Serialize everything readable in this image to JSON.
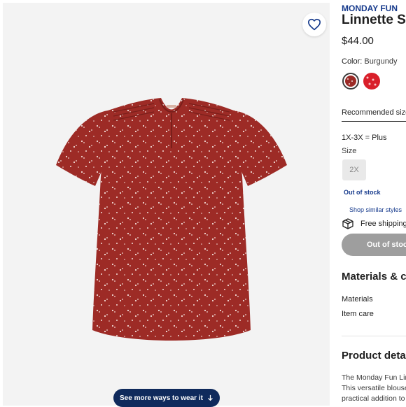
{
  "product": {
    "brand": "MONDAY FUN",
    "name": "Linnette Sp",
    "price": "$44.00"
  },
  "color": {
    "label": "Color:",
    "value": "Burgundy",
    "swatches": [
      {
        "name": "Burgundy",
        "hex": "#9b2a26"
      },
      {
        "name": "Red",
        "hex": "#d91f2a"
      }
    ]
  },
  "sizing": {
    "recommended": "Recommended size",
    "range": "1X-3X = Plus",
    "label": "Size",
    "option": "2X",
    "status": "Out of stock"
  },
  "links": {
    "shop_similar": "Shop similar styles"
  },
  "shipping": {
    "text": "Free shipping"
  },
  "cta": {
    "label": "Out of stock"
  },
  "materials": {
    "title": "Materials & ca",
    "row1": "Materials",
    "row2": "Item care"
  },
  "details": {
    "title": "Product detai",
    "lines": [
      "The Monday Fun Lin",
      "This versatile blouse",
      "practical addition to"
    ]
  },
  "gallery": {
    "wear_button": "See more ways to wear it"
  },
  "colors": {
    "accent": "#163a8c",
    "button_dark": "#0f2a5c",
    "disabled": "#9e9e9e",
    "blouse": "#9d2b26"
  },
  "icons": [
    "heart-icon",
    "down-arrow-icon",
    "box-icon"
  ]
}
